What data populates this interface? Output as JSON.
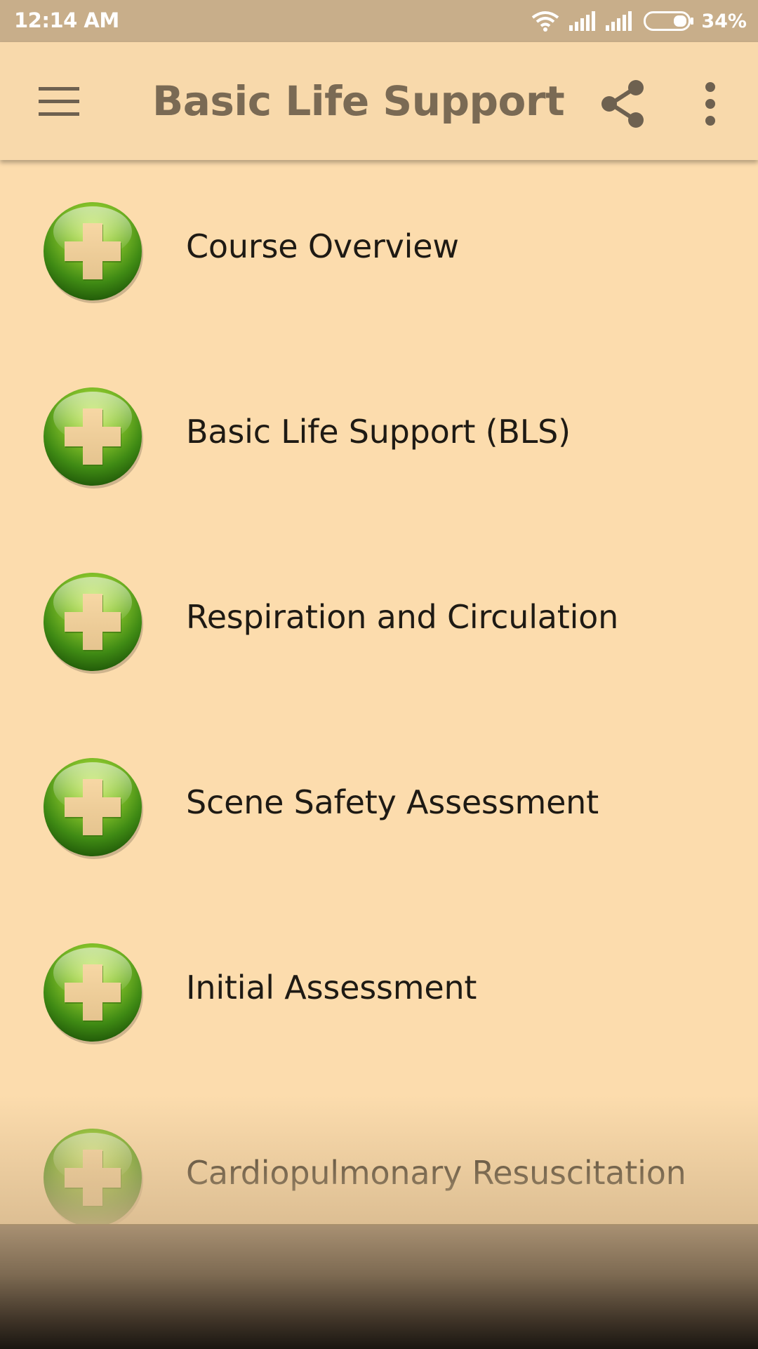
{
  "status_bar": {
    "time": "12:14 AM",
    "battery_percent": "34%",
    "icons": [
      "wifi-icon",
      "signal-icon",
      "signal-icon",
      "battery-icon"
    ]
  },
  "app_bar": {
    "title": "Basic Life Support",
    "icons": {
      "menu": "hamburger-menu-icon",
      "share": "share-icon",
      "more": "more-vertical-icon"
    }
  },
  "list": {
    "items": [
      {
        "label": "Course Overview",
        "icon": "green-cross-icon"
      },
      {
        "label": "Basic Life Support (BLS)",
        "icon": "green-cross-icon"
      },
      {
        "label": "Respiration and Circulation",
        "icon": "green-cross-icon"
      },
      {
        "label": "Scene Safety Assessment",
        "icon": "green-cross-icon"
      },
      {
        "label": "Initial Assessment",
        "icon": "green-cross-icon"
      },
      {
        "label": "Cardiopulmonary Resuscitation",
        "icon": "green-cross-icon"
      }
    ]
  },
  "colors": {
    "background": "#fcdcad",
    "app_bar": "#f8d9ab",
    "status_bar": "#c8ae8a",
    "title_text": "#7a6a54",
    "icon_green": "#5fa31c"
  }
}
